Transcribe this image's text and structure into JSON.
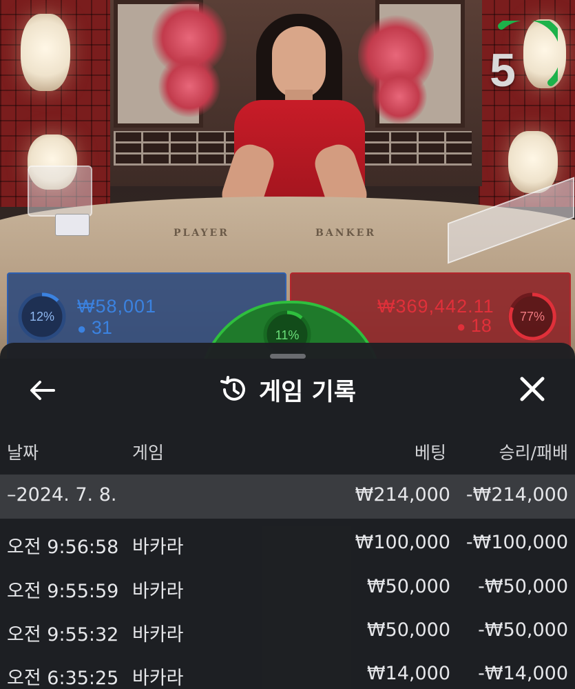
{
  "timer": {
    "value": "5",
    "color": "#1db24a"
  },
  "bets": {
    "player": {
      "percent": "12%",
      "amount": "₩58,001",
      "count": "31",
      "color": "#3b82e0"
    },
    "banker": {
      "percent": "77%",
      "amount": "₩369,442.11",
      "count": "18",
      "color": "#c8262e"
    },
    "tie": {
      "percent": "11%",
      "color": "#2fbf3e"
    }
  },
  "table_labels": {
    "player": "PLAYER",
    "banker": "BANKER"
  },
  "sheet": {
    "title": "게임 기록",
    "icons": {
      "back": "back-arrow-icon",
      "history": "history-icon",
      "close": "close-icon"
    }
  },
  "columns": {
    "date": "날짜",
    "game": "게임",
    "bet": "베팅",
    "result": "승리/패배"
  },
  "date_group": {
    "label": "–2024. 7. 8.",
    "bet": "₩214,000",
    "result": "-₩214,000"
  },
  "rows": [
    {
      "time": "오전 9:56:58",
      "game": "바카라",
      "bet": "₩100,000",
      "result": "-₩100,000"
    },
    {
      "time": "오전 9:55:59",
      "game": "바카라",
      "bet": "₩50,000",
      "result": "-₩50,000"
    },
    {
      "time": "오전 9:55:32",
      "game": "바카라",
      "bet": "₩50,000",
      "result": "-₩50,000"
    },
    {
      "time": "오전 6:35:25",
      "game": "바카라",
      "bet": "₩14,000",
      "result": "-₩14,000"
    }
  ]
}
